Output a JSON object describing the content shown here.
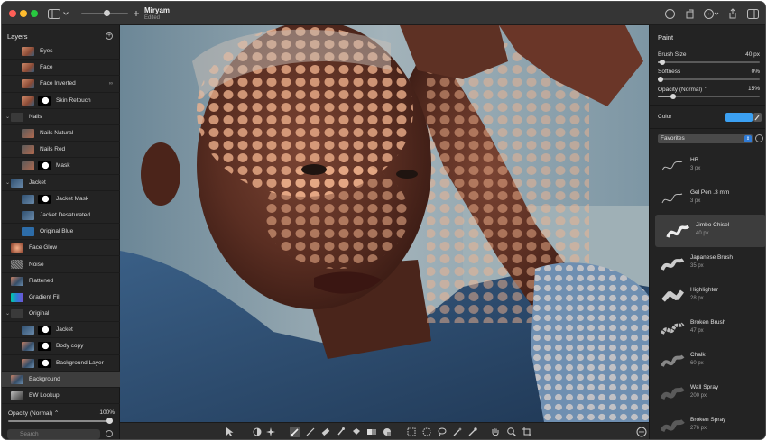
{
  "titlebar": {
    "title": "Miryam",
    "subtitle": "Edited",
    "left_icons": [
      "sidebar-toggle-icon",
      "zoom-slider",
      "chevron-icon"
    ],
    "right_icons": [
      "info-icon",
      "rotate-icon",
      "more-icon",
      "share-icon",
      "sidebar-right-icon"
    ]
  },
  "layers": {
    "header": "Layers",
    "items": [
      {
        "name": "Eyes",
        "indent": 1,
        "thumb": "face",
        "mask": false,
        "disclosure": ""
      },
      {
        "name": "Face",
        "indent": 1,
        "thumb": "face",
        "mask": false,
        "disclosure": ""
      },
      {
        "name": "Face Inverted",
        "indent": 1,
        "thumb": "face",
        "mask": false,
        "disclosure": "",
        "badge": "link-icon"
      },
      {
        "name": "Skin Retouch",
        "indent": 1,
        "thumb": "face",
        "mask": true,
        "disclosure": ""
      },
      {
        "name": "Nails",
        "indent": 0,
        "thumb": "",
        "mask": false,
        "disclosure": "expanded"
      },
      {
        "name": "Nails Natural",
        "indent": 1,
        "thumb": "nails",
        "mask": false,
        "disclosure": ""
      },
      {
        "name": "Nails Red",
        "indent": 1,
        "thumb": "nails",
        "mask": false,
        "disclosure": ""
      },
      {
        "name": "Mask",
        "indent": 1,
        "thumb": "nails",
        "mask": true,
        "disclosure": ""
      },
      {
        "name": "Jacket",
        "indent": 0,
        "thumb": "jacket",
        "mask": false,
        "disclosure": "expanded"
      },
      {
        "name": "Jacket Mask",
        "indent": 1,
        "thumb": "jacket",
        "mask": true,
        "disclosure": ""
      },
      {
        "name": "Jacket Desaturated",
        "indent": 1,
        "thumb": "jacket",
        "mask": false,
        "disclosure": ""
      },
      {
        "name": "Original Blue",
        "indent": 1,
        "thumb": "blue",
        "mask": false,
        "disclosure": ""
      },
      {
        "name": "Face Glow",
        "indent": 0,
        "thumb": "glow",
        "mask": false,
        "disclosure": ""
      },
      {
        "name": "Noise",
        "indent": 0,
        "thumb": "noise",
        "mask": false,
        "disclosure": ""
      },
      {
        "name": "Flattened",
        "indent": 0,
        "thumb": "photo",
        "mask": false,
        "disclosure": ""
      },
      {
        "name": "Gradient Fill",
        "indent": 0,
        "thumb": "grad",
        "mask": false,
        "disclosure": ""
      },
      {
        "name": "Original",
        "indent": 0,
        "thumb": "",
        "mask": false,
        "disclosure": "expanded"
      },
      {
        "name": "Jacket",
        "indent": 1,
        "thumb": "jacket",
        "mask": true,
        "disclosure": ""
      },
      {
        "name": "Body copy",
        "indent": 1,
        "thumb": "photo",
        "mask": true,
        "disclosure": ""
      },
      {
        "name": "Background Layer",
        "indent": 1,
        "thumb": "photo",
        "mask": true,
        "disclosure": ""
      },
      {
        "name": "Background",
        "indent": 0,
        "thumb": "photo",
        "mask": false,
        "disclosure": "",
        "selected": true
      },
      {
        "name": "BW Lookup",
        "indent": 0,
        "thumb": "bw",
        "mask": false,
        "disclosure": ""
      }
    ],
    "opacity_label": "Opacity (Normal) ⌃",
    "opacity_value": "100%",
    "opacity_level": 1.0,
    "search_placeholder": "Search"
  },
  "toolbar": {
    "tools": [
      "arrow-tool-icon",
      "color-adjust-icon",
      "magic-icon",
      "brush-tool-icon",
      "pen-tool-icon",
      "eraser-icon",
      "clone-icon",
      "fill-icon",
      "gradient-icon",
      "shape-icon",
      "rect-select-icon",
      "ellipse-select-icon",
      "lasso-icon",
      "magic-wand-icon",
      "eyedropper-icon",
      "hand-icon",
      "zoom-icon",
      "crop-icon",
      "more-icon"
    ],
    "active_tool": "brush-tool-icon"
  },
  "paint": {
    "title": "Paint",
    "brush_size_label": "Brush Size",
    "brush_size_value": "40 px",
    "brush_size_level": 0.04,
    "softness_label": "Softness",
    "softness_value": "0%",
    "softness_level": 0.0,
    "opacity_label": "Opacity (Normal) ⌃",
    "opacity_value": "15%",
    "opacity_level": 0.15,
    "color_label": "Color",
    "color_value": "#3ba0f2",
    "preset_group": "Favorites",
    "brushes": [
      {
        "name": "HB",
        "size": "3 px",
        "stroke": "thin"
      },
      {
        "name": "Gel Pen .3 mm",
        "size": "3 px",
        "stroke": "thin"
      },
      {
        "name": "Jimbo Chisel",
        "size": "40 px",
        "stroke": "chisel",
        "selected": true
      },
      {
        "name": "Japanese Brush",
        "size": "35 px",
        "stroke": "brush"
      },
      {
        "name": "Highlighter",
        "size": "28 px",
        "stroke": "highlighter"
      },
      {
        "name": "Broken Brush",
        "size": "47 px",
        "stroke": "broken"
      },
      {
        "name": "Chalk",
        "size": "60 px",
        "stroke": "chalk"
      },
      {
        "name": "Wall Spray",
        "size": "200 px",
        "stroke": "spray"
      },
      {
        "name": "Broken Spray",
        "size": "276 px",
        "stroke": "spray"
      }
    ]
  }
}
